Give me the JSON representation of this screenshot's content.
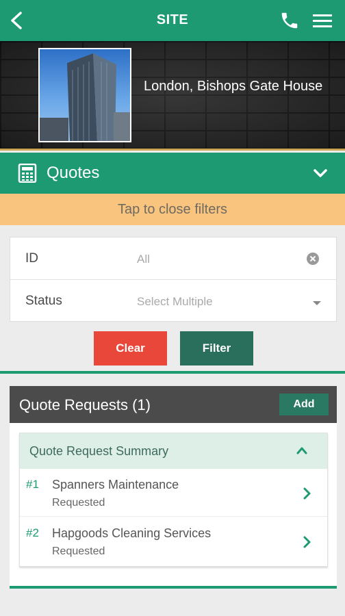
{
  "header": {
    "title": "SITE",
    "icons": [
      "back-arrow-icon",
      "phone-icon",
      "hamburger-menu-icon"
    ]
  },
  "site": {
    "name": "London, Bishops Gate House"
  },
  "section": {
    "title": "Quotes",
    "icon": "calculator-icon"
  },
  "filters": {
    "toggle_label": "Tap to close filters",
    "id_label": "ID",
    "id_value": "All",
    "status_label": "Status",
    "status_placeholder": "Select Multiple",
    "clear_label": "Clear",
    "filter_label": "Filter"
  },
  "quote_requests": {
    "title": "Quote Requests (1)",
    "add_label": "Add",
    "summary_title": "Quote Request Summary",
    "items": [
      {
        "num": "#1",
        "name": "Spanners Maintenance",
        "status": "Requested"
      },
      {
        "num": "#2",
        "name": "Hapgoods Cleaning Services",
        "status": "Requested"
      }
    ]
  },
  "colors": {
    "primary": "#1e9a73",
    "filter_bar": "#f8c47e",
    "clear": "#e8473a",
    "filter": "#2a6e5c",
    "panel_head": "#4b4b4b"
  }
}
